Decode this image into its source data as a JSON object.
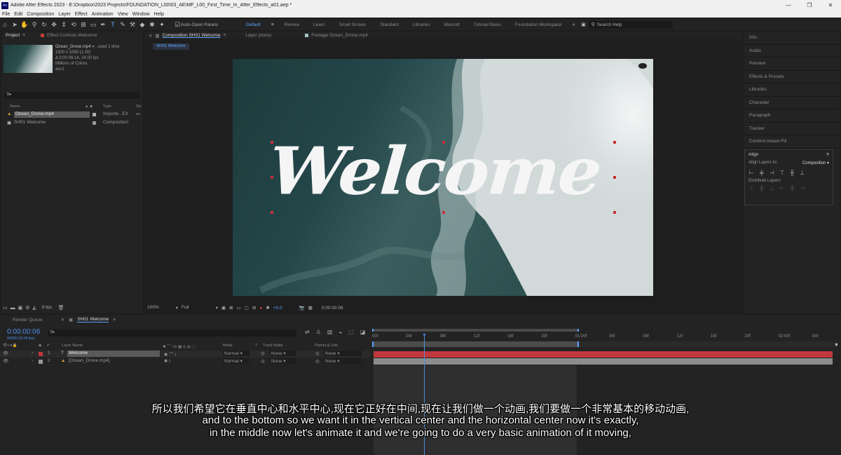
{
  "window": {
    "title": "Adobe After Effects 2023 - E:\\Dropbox\\2023 Projects\\FOUNDATION_L00\\03_AE\\MF_L00_First_Time_In_After_Effects_a01.aep *",
    "app_icon": "Ae",
    "minimize": "—",
    "maximize": "❐",
    "close": "✕"
  },
  "menu": [
    "File",
    "Edit",
    "Composition",
    "Layer",
    "Effect",
    "Animation",
    "View",
    "Window",
    "Help"
  ],
  "toolbar": {
    "auto_open_panels": "Auto-Open Panels",
    "workspaces": [
      "Default",
      "Review",
      "Learn",
      "Small Screen",
      "Standard",
      "Libraries",
      "Marriott",
      "Tutorial Basic",
      "Foundation Workspace"
    ],
    "active_workspace": "Default",
    "search_help": "Search Help"
  },
  "project_panel": {
    "tab": "Project",
    "effect_controls_tab": "Effect Controls Welcome",
    "selected_item": {
      "name": "Ocean_Drone.mp4",
      "used": ", used 1 time",
      "size": "1920 x 1080 (1.00)",
      "duration": "Δ 0:00:06:14, 24.00 fps",
      "colors": "Millions of Colors",
      "codec": "avc1"
    },
    "columns": [
      "Name",
      "Type",
      "Siz"
    ],
    "items": [
      {
        "name": "Ocean_Drone.mp4",
        "type": "Importe...EX"
      },
      {
        "name": "SH01 Welcome",
        "type": "Composition"
      }
    ],
    "bpc": "8 bpc"
  },
  "comp_panel": {
    "tab": "Composition SH01 Welcome",
    "layer_tab": "Layer (none)",
    "footage_tab": "Footage Ocean_Drone.mp4",
    "breadcrumb": "SH01 Welcome",
    "comp_text": "Welcome",
    "zoom": "100%",
    "resolution": "Full",
    "exposure": "+0.0",
    "timecode": "0:00:00:06"
  },
  "right_panel": {
    "items": [
      "Info",
      "Audio",
      "Preview",
      "Effects & Presets",
      "Libraries",
      "Character",
      "Paragraph",
      "Tracker",
      "Content-Aware Fill"
    ],
    "align": {
      "title": "Align",
      "align_layers_to": "Align Layers to:",
      "target": "Composition",
      "distribute": "Distribute Layers:"
    }
  },
  "timeline": {
    "render_queue_tab": "Render Queue",
    "comp_tab": "SH01 Welcome",
    "timecode": "0:00:00:06",
    "frame_info": "00006 (24.00 fps)",
    "columns": {
      "layer_name": "Layer Name",
      "mode": "Mode",
      "t": "T",
      "track_matte": "Track Matte",
      "parent": "Parent & Link"
    },
    "layers": [
      {
        "num": "1",
        "name": "Welcome",
        "mode": "Normal",
        "matte": "None",
        "parent": "None",
        "color": "#c0383c"
      },
      {
        "num": "2",
        "name": "[Ocean_Drone.mp4]",
        "mode": "Normal",
        "matte": "None",
        "parent": "None",
        "color": "#8a8a8a"
      }
    ],
    "ruler": [
      "00f",
      "04f",
      "08f",
      "12f",
      "16f",
      "20f",
      "01:00f",
      "04f",
      "08f",
      "12f",
      "16f",
      "20f",
      "02:00f",
      "04f"
    ]
  },
  "subtitles": {
    "line1": "所以我们希望它在垂直中心和水平中心,现在它正好在中间,现在让我们做一个动画,我们要做一个非常基本的移动动画,",
    "line2": "and to the bottom so we want it in the vertical center and the horizontal center now it's exactly,",
    "line3": "in the middle now let's animate it and we're going to do a very basic animation of it moving,"
  },
  "colors": {
    "accent_blue": "#5aa3ff",
    "layer_bar_red": "#c0383c",
    "layer_bar_gray": "#8c8c8c",
    "timecode_blue": "#4a8fe7"
  }
}
